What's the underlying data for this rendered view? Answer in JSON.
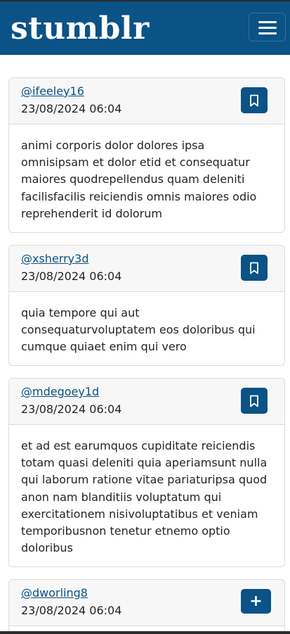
{
  "app": {
    "brand": "stumblr",
    "menu_icon": "hamburger-menu-icon",
    "brand_color": "#0b5286"
  },
  "posts": [
    {
      "username": "@ifeeley16",
      "timestamp": "23/08/2024 06:04",
      "action_icon": "bookmark-icon",
      "content": "animi corporis dolor dolores ipsa omnisipsam et dolor etid et consequatur maiores quodrepellendus quam deleniti facilisfacilis reiciendis omnis maiores odio reprehenderit id dolorum"
    },
    {
      "username": "@xsherry3d",
      "timestamp": "23/08/2024 06:04",
      "action_icon": "bookmark-icon",
      "content": "quia tempore qui aut consequaturvoluptatem eos doloribus qui cumque quiaet enim qui vero"
    },
    {
      "username": "@mdegoey1d",
      "timestamp": "23/08/2024 06:04",
      "action_icon": "bookmark-icon",
      "content": "et ad est earumquos cupiditate reiciendis totam quasi deleniti quia aperiamsunt nulla qui laborum ratione vitae pariaturipsa quod anon nam blanditiis voluptatum qui exercitationem nisivoluptatibus et veniam temporibusnon tenetur etnemo optio doloribus"
    },
    {
      "username": "@dworling8",
      "timestamp": "23/08/2024 06:04",
      "action_icon": "plus-icon",
      "action_label": "+"
    }
  ]
}
